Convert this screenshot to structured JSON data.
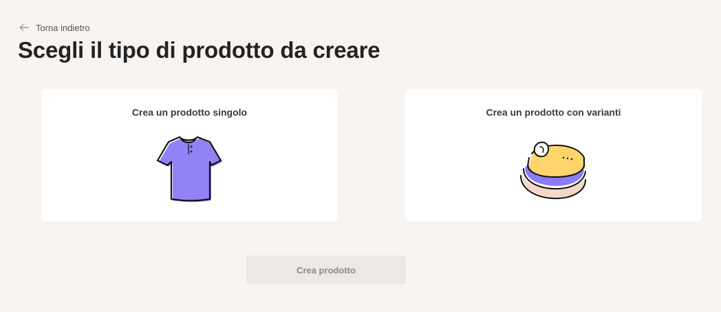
{
  "navigation": {
    "back_label": "Torna indietro",
    "back_icon": "arrow-left-icon"
  },
  "page": {
    "title": "Scegli il tipo di prodotto da creare"
  },
  "options": [
    {
      "title": "Crea un prodotto singolo",
      "icon": "tshirt-icon"
    },
    {
      "title": "Crea un prodotto con varianti",
      "icon": "folded-clothes-icon"
    }
  ],
  "actions": {
    "create_label": "Crea prodotto"
  },
  "colors": {
    "background": "#f8f4f1",
    "card": "#ffffff",
    "purple": "#8b7cf6",
    "yellow": "#ffd56b",
    "peach": "#f6d8c8",
    "button_disabled_bg": "#ece8e5",
    "button_disabled_text": "#8d8a87"
  }
}
